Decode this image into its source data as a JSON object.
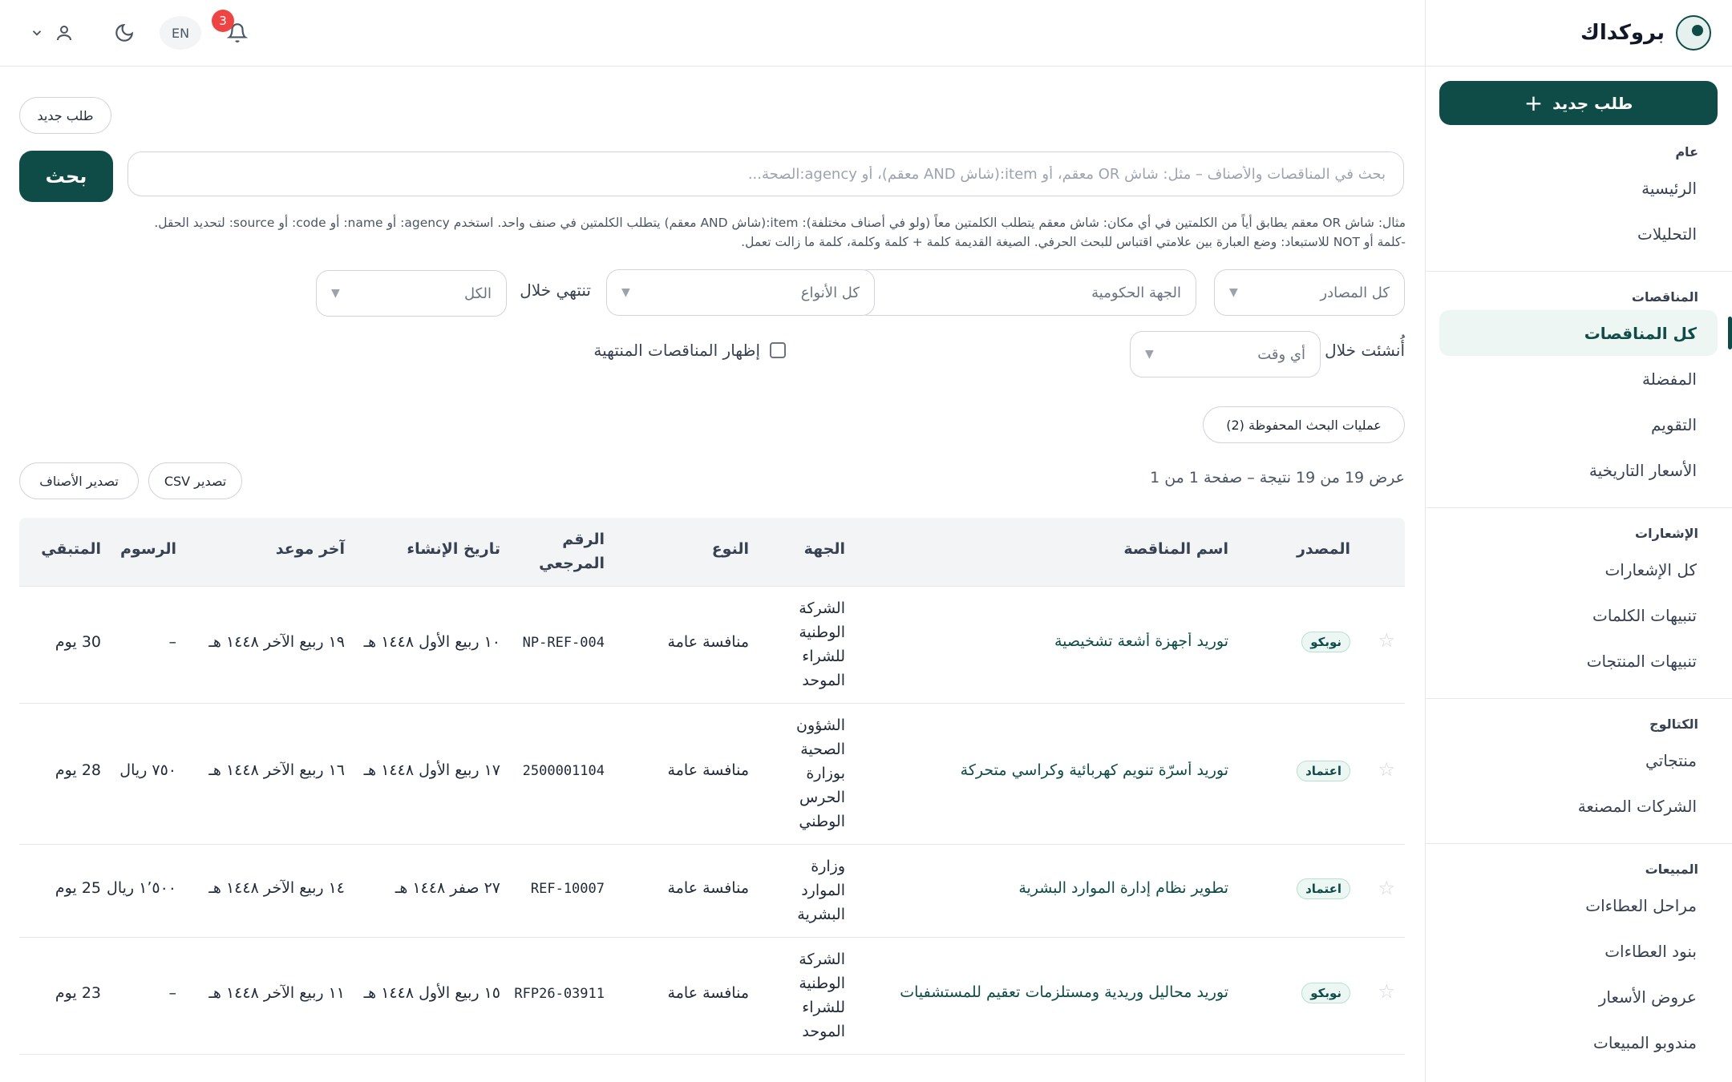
{
  "brand": {
    "name": "بروكداك"
  },
  "sidebar": {
    "new_request": "طلب جديد",
    "sections": [
      {
        "title": "عام",
        "items": [
          "الرئيسية",
          "التحليلات"
        ]
      },
      {
        "title": "المناقصات",
        "items": [
          "كل المناقصات",
          "المفضلة",
          "التقويم",
          "الأسعار التاريخية"
        ]
      },
      {
        "title": "الإشعارات",
        "items": [
          "كل الإشعارات",
          "تنبيهات الكلمات",
          "تنبيهات المنتجات"
        ]
      },
      {
        "title": "الكتالوج",
        "items": [
          "منتجاتي",
          "الشركات المصنعة"
        ]
      },
      {
        "title": "المبيعات",
        "items": [
          "مراحل العطاءات",
          "بنود العطاءات",
          "عروض الأسعار",
          "مندوبو المبيعات"
        ]
      }
    ],
    "active_item": "كل المناقصات"
  },
  "topbar": {
    "notif_count": "3",
    "lang": "EN"
  },
  "main": {
    "new_request": "طلب جديد",
    "search_placeholder": "بحث في المناقصات والأصناف – مثل: شاش OR معقم، أو item:(شاش AND معقم)، أو agency:الصحة...",
    "search_button": "بحث",
    "hint_line1": "مثال: شاش OR معقم يطابق أياً من الكلمتين في أي مكان: شاش معقم يتطلب الكلمتين معاً (ولو في أصناف مختلفة): item:(شاش AND معقم) يتطلب الكلمتين في صنف واحد. استخدم agency: أو name: أو code: أو source: لتحديد الحقل.",
    "hint_line2": "-كلمة أو NOT للاستبعاد: وضع العبارة بين علامتي اقتباس للبحث الحرفي. الصيغة القديمة كلمة + كلمة وكلمة، كلمة ما زالت تعمل.",
    "filters": {
      "source": "كل المصادر",
      "agency_placeholder": "الجهة الحكومية",
      "type": "كل الأنواع",
      "ends_label": "تنتهي خلال",
      "ends_value": "الكل",
      "created_label": "أُنشئت خلال",
      "created_value": "أي وقت",
      "show_expired": "إظهار المناقصات المنتهية"
    },
    "saved_searches": "عمليات البحث المحفوظة (2)",
    "results_text": "عرض 19 من 19 نتيجة – صفحة 1 من 1",
    "export_csv": "تصدير CSV",
    "export_items": "تصدير الأصناف"
  },
  "table": {
    "headers": {
      "source": "المصدر",
      "name": "اسم المناقصة",
      "agency": "الجهة",
      "type": "النوع",
      "ref": "الرقم المرجعي",
      "created": "تاريخ الإنشاء",
      "deadline": "آخر موعد",
      "fees": "الرسوم",
      "remaining": "المتبقي"
    },
    "rows": [
      {
        "source": "نوبكو",
        "name": "توريد أجهزة أشعة تشخيصية",
        "agency": "الشركة الوطنية للشراء الموحد",
        "type": "منافسة عامة",
        "ref": "NP-REF-004",
        "created": "١٠ ربيع الأول ١٤٤٨ هـ",
        "deadline": "١٩ ربيع الآخر ١٤٤٨ هـ",
        "fees": "–",
        "remaining": "30 يوم"
      },
      {
        "source": "اعتماد",
        "name": "توريد أسرّة تنويم كهربائية وكراسي متحركة",
        "agency": "الشؤون الصحية بوزارة الحرس الوطني",
        "type": "منافسة عامة",
        "ref": "2500001104",
        "created": "١٧ ربيع الأول ١٤٤٨ هـ",
        "deadline": "١٦ ربيع الآخر ١٤٤٨ هـ",
        "fees": "٧٥٠ ريال",
        "remaining": "28 يوم"
      },
      {
        "source": "اعتماد",
        "name": "تطوير نظام إدارة الموارد البشرية",
        "agency": "وزارة الموارد البشرية",
        "type": "منافسة عامة",
        "ref": "REF-10007",
        "created": "٢٧ صفر ١٤٤٨ هـ",
        "deadline": "١٤ ربيع الآخر ١٤٤٨ هـ",
        "fees": "١٬٥٠٠ ريال",
        "remaining": "25 يوم"
      },
      {
        "source": "نوبكو",
        "name": "توريد محاليل وريدية ومستلزمات تعقيم للمستشفيات",
        "agency": "الشركة الوطنية للشراء الموحد",
        "type": "منافسة عامة",
        "ref": "RFP26-03911",
        "created": "١٥ ربيع الأول ١٤٤٨ هـ",
        "deadline": "١١ ربيع الآخر ١٤٤٨ هـ",
        "fees": "–",
        "remaining": "23 يوم"
      }
    ]
  }
}
